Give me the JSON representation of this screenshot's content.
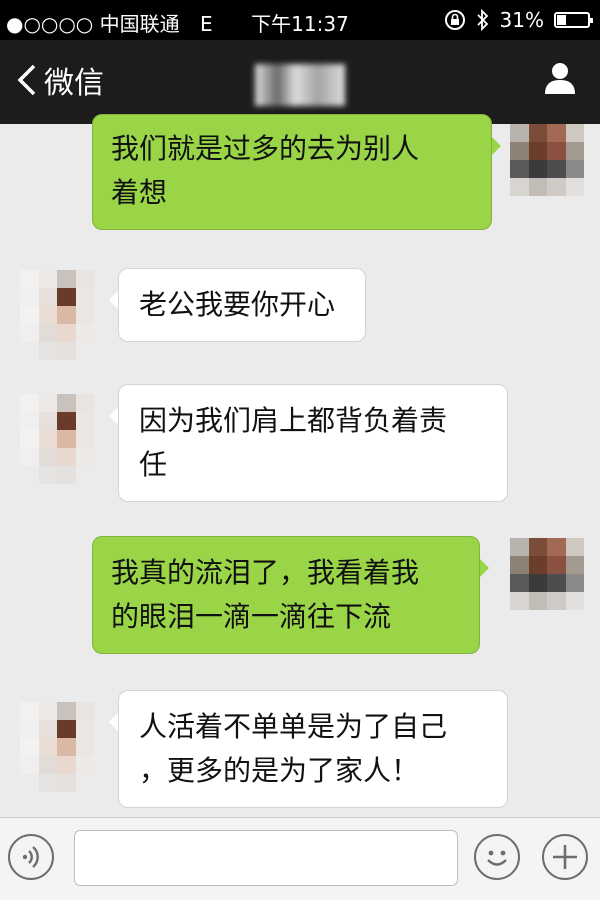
{
  "status_bar": {
    "carrier": "●○○○○ 中国联通",
    "network": "E",
    "time": "下午11:37",
    "battery_percent": "31%",
    "battery_level": 0.31,
    "icons": [
      "rotation-lock-icon",
      "bluetooth-icon",
      "battery-icon"
    ]
  },
  "nav": {
    "back_label": "微信",
    "back_icon": "chevron-left-icon",
    "profile_icon": "person-icon"
  },
  "messages": [
    {
      "side": "out",
      "lines": [
        "我们就是过多的去为别人",
        "着想"
      ]
    },
    {
      "side": "in",
      "lines": [
        "老公我要你开心"
      ]
    },
    {
      "side": "in",
      "lines": [
        "因为我们肩上都背负着责",
        "任"
      ]
    },
    {
      "side": "out",
      "lines": [
        "我真的流泪了，我看着我",
        "的眼泪一滴一滴往下流"
      ]
    },
    {
      "side": "in",
      "lines": [
        "人活着不单单是为了自己",
        "，更多的是为了家人！"
      ]
    }
  ],
  "input_bar": {
    "voice_icon": "voice-icon",
    "input_value": "",
    "emoji_icon": "emoji-icon",
    "plus_icon": "plus-icon"
  },
  "colors": {
    "bubble_out": "#9ad547",
    "bubble_in": "#ffffff",
    "background": "#ebebeb",
    "navbar": "#1c1c1c"
  }
}
